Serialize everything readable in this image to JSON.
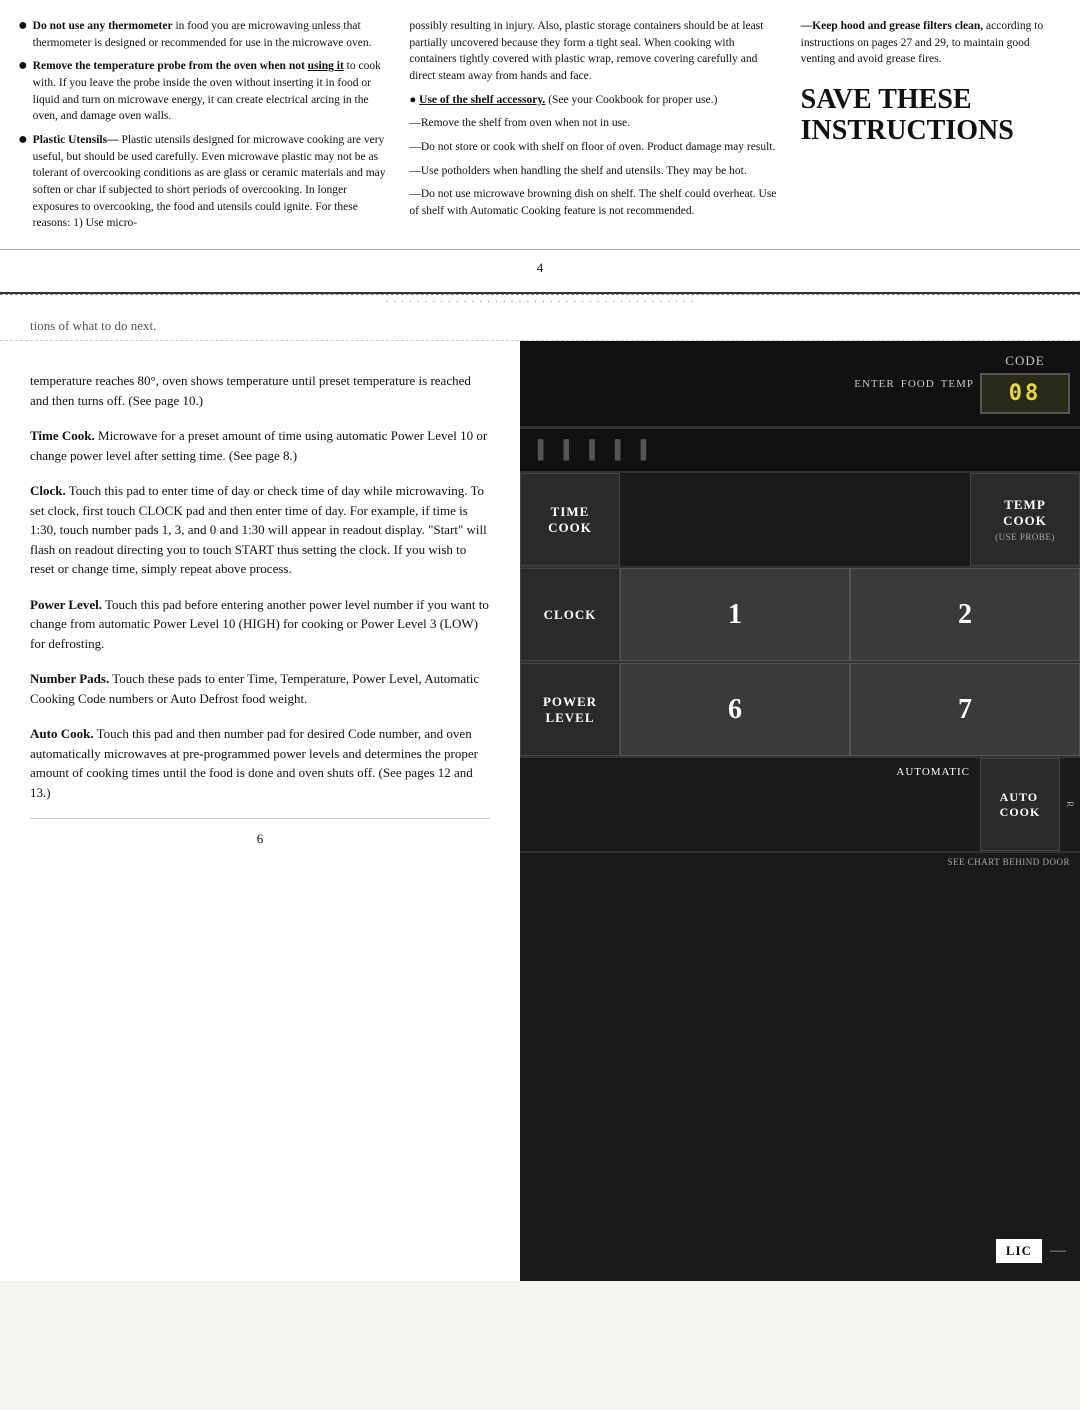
{
  "top": {
    "col1": {
      "items": [
        {
          "type": "bullet",
          "title": "Do not use any thermometer",
          "body": "in food you are microwaving unless that thermometer is designed or recommended for use in the microwave oven."
        },
        {
          "type": "bullet",
          "title": "Remove the temperature probe from the oven when not",
          "titleUnderline": "using it",
          "body": "to cook with. If you leave the probe inside the oven without inserting it in food or liquid and turn on microwave energy, it can create electrical arcing in the oven, and damage oven walls."
        },
        {
          "type": "bullet",
          "title": "Plastic Utensils—",
          "titleRest": "Plastic utensils designed for microwave cooking are very useful, but should be used carefully. Even microwave plastic may not be as tolerant of overcooking conditions as are glass or ceramic materials and may soften or char if subjected to short periods of overcooking. In longer exposures to overcooking, the food and utensils could ignite. For these reasons: 1) Use micro-"
        }
      ]
    },
    "col2": {
      "paragraphs": [
        "possibly resulting in injury. Also, plastic storage containers should be at least partially uncovered because they form a tight seal. When cooking with containers tightly covered with plastic wrap, remove covering carefully and direct steam away from hands and face.",
        "● Use of the shelf accessory. (See your Cookbook for proper use.)",
        "—Remove the shelf from oven when not in use.",
        "—Do not store or cook with shelf on floor of oven. Product damage may result.",
        "—Use potholders when handling the shelf and utensils. They may be hot.",
        "—Do not use microwave browning dish on shelf. The shelf could overheat. Use of shelf with Automatic Cooking feature is not recommended."
      ]
    },
    "col3": {
      "keepHoodText": "—Keep hood and grease filters clean, according to instructions on pages 27 and 29, to maintain good venting and avoid grease fires.",
      "saveThese": "SAVE THESE\nINSTRUCTIONS"
    },
    "pageNumber": "4"
  },
  "bottom": {
    "partialText": "tions of what to do next.",
    "sections": [
      {
        "id": "temp-cook",
        "text": "temperature reaches 80°, oven shows temperature until preset temperature is reached and then turns off. (See page 10.)"
      },
      {
        "id": "time-cook",
        "title": "Time Cook.",
        "body": "Microwave for a preset amount of time using automatic Power Level 10 or change power level after setting time. (See page 8.)"
      },
      {
        "id": "clock",
        "title": "Clock.",
        "body": "Touch this pad to enter time of day or check time of day while microwaving. To set clock, first touch CLOCK pad and then enter time of day. For example, if time is 1:30, touch number pads 1, 3, and 0 and 1:30 will appear in readout display. \"Start\" will flash on readout directing you to touch START thus setting the clock. If you wish to reset or change time, simply repeat above process."
      },
      {
        "id": "power-level",
        "title": "Power Level.",
        "body": "Touch this pad before entering another power level number if you want to change from automatic Power Level 10 (HIGH) for cooking or Power Level 3 (LOW) for defrosting."
      },
      {
        "id": "number-pads",
        "title": "Number Pads.",
        "body": "Touch these pads to enter Time, Temperature, Power Level, Automatic Cooking Code numbers or Auto Defrost food weight."
      },
      {
        "id": "auto-cook",
        "title": "Auto Cook.",
        "body": "Touch this pad and then number pad for desired Code number, and oven automatically microwaves at pre-programmed power levels and determines the proper amount of cooking times until the food is done and oven shuts off. (See pages 12 and 13.)"
      }
    ],
    "pageNumber": "6",
    "microwave": {
      "display": {
        "labels": [
          "ENTER",
          "FOOD",
          "TEMP"
        ],
        "code": "CODE",
        "screen": "08"
      },
      "segmentBar": {
        "segments": [
          "▌",
          "▌",
          "▌",
          "▌",
          "▌"
        ]
      },
      "buttons": [
        {
          "id": "time-cook",
          "label": "TIME\nCOOK",
          "sublabel": "",
          "numbers": []
        },
        {
          "id": "temp-cook",
          "label": "TEMP\nCOOK",
          "sublabel": "(USE PROBE)",
          "numbers": []
        },
        {
          "id": "clock",
          "label": "CLOCK",
          "sublabel": "",
          "numbers": [
            "1",
            "2"
          ]
        },
        {
          "id": "power-level",
          "label": "POWER\nLEVEL",
          "sublabel": "",
          "numbers": [
            "6",
            "7"
          ]
        }
      ],
      "autoSection": {
        "label": "AUTOMATIC",
        "button": "AUTO\nCOOK",
        "seeChart": "SEE CHART BEHIND DOOR"
      },
      "licBadge": "LIC"
    }
  }
}
